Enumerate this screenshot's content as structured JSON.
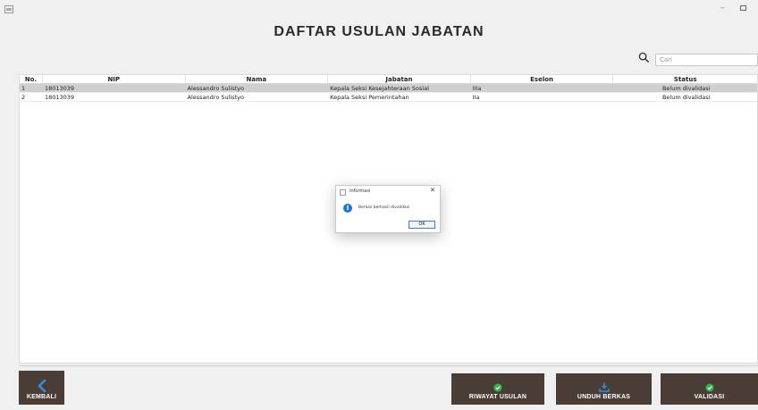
{
  "window": {
    "minimize_glyph": "–"
  },
  "page": {
    "title": "DAFTAR USULAN JABATAN"
  },
  "search": {
    "placeholder": "Cari",
    "icon": "search-icon"
  },
  "table": {
    "columns": [
      "No.",
      "NIP",
      "Nama",
      "Jabatan",
      "Eselon",
      "Status"
    ],
    "rows": [
      {
        "no": "1",
        "nip": "18013039",
        "nama": "Alessandro Sulistyo",
        "jabatan": "Kepala Seksi Kesejahteraan Sosial",
        "eselon": "IIIa",
        "status": "Belum divalidasi"
      },
      {
        "no": "2",
        "nip": "18013039",
        "nama": "Alessandro Sulistyo",
        "jabatan": "Kepala Seksi Pemerintahan",
        "eselon": "IIa",
        "status": "Belum divalidasi"
      }
    ],
    "selected_row": 0
  },
  "buttons": {
    "kembali": {
      "label": "KEMBALI",
      "icon": "chevron-left-icon"
    },
    "riwayat": {
      "label": "RIWAYAT USULAN",
      "icon": "history-check-icon"
    },
    "unduh": {
      "label": "UNDUH BERKAS",
      "icon": "download-icon"
    },
    "validasi": {
      "label": "VALIDASI",
      "icon": "check-circle-icon"
    }
  },
  "dialog": {
    "title": "Informasi",
    "message": "Berkas berhasil divalidasi",
    "ok_label": "OK",
    "close_glyph": "✕",
    "info_glyph": "i"
  },
  "colors": {
    "button_bg": "#4a3d35",
    "accent_blue": "#1e74d2",
    "icon_green": "#2eb84a",
    "selected_row": "#cfcfcf"
  }
}
